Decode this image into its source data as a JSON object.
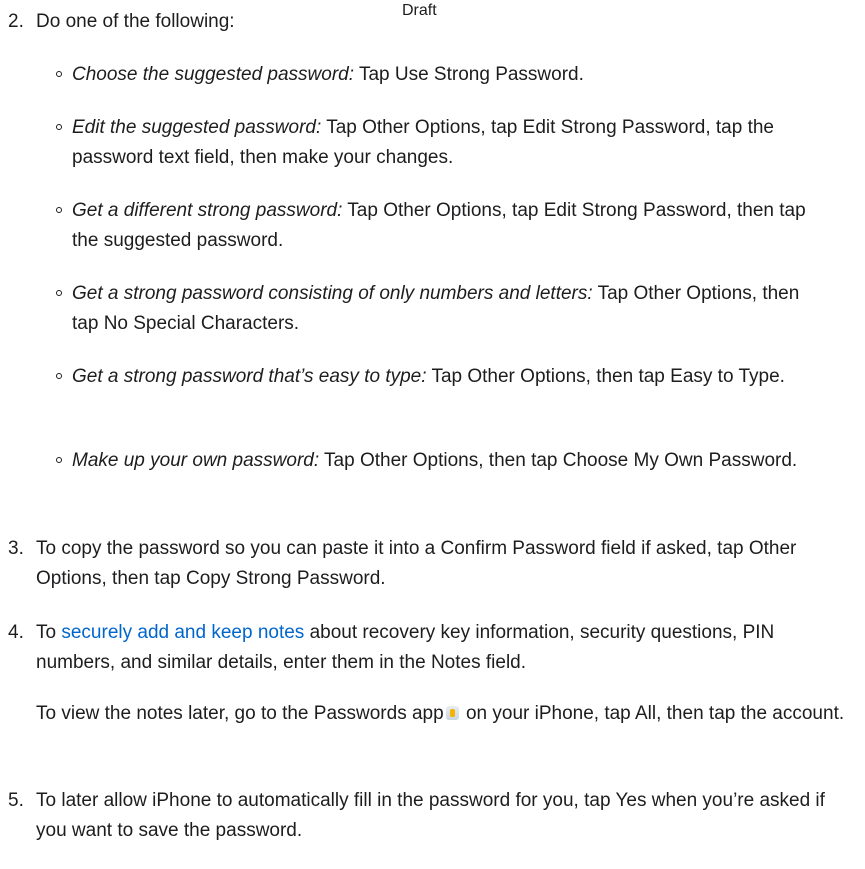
{
  "header": {
    "draft_label": "Draft"
  },
  "steps": [
    {
      "number": "2.",
      "text": "Do one of the following:",
      "options": [
        {
          "italic": "Choose the suggested password:",
          "text": " Tap Use Strong Password."
        },
        {
          "italic": "Edit the suggested password:",
          "text": " Tap Other Options, tap Edit Strong Password, tap the password text field, then make your changes."
        },
        {
          "italic": "Get a different strong password:",
          "text": " Tap Other Options, tap Edit Strong Password, then tap the suggested password."
        },
        {
          "italic": "Get a strong password consisting of only numbers and letters:",
          "text": " Tap Other Options, then tap No Special Characters."
        },
        {
          "italic": "Get a strong password that’s easy to type:",
          "text": " Tap Other Options, then tap Easy to Type."
        },
        {
          "italic": "Make up your own password:",
          "text": " Tap Other Options, then tap Choose My Own Password."
        }
      ]
    },
    {
      "number": "3.",
      "text": "To copy the password so you can paste it into a Confirm Password field if asked, tap Other Options, then tap Copy Strong Password."
    },
    {
      "number": "4.",
      "text_before": "To ",
      "link": "securely add and keep notes",
      "text_after": " about recovery key information, security questions, PIN numbers, and similar details, enter them in the Notes field.",
      "sub_before": "To view the notes later, go to the Passwords app",
      "sub_icon": "passwords-app-icon",
      "sub_after": " on your iPhone, tap All, then tap the account."
    },
    {
      "number": "5.",
      "text": "To later allow iPhone to automatically fill in the password for you, tap Yes when you’re asked if you want to save the password."
    }
  ],
  "colors": {
    "text": "#1d1d1f",
    "link": "#0066cc"
  }
}
